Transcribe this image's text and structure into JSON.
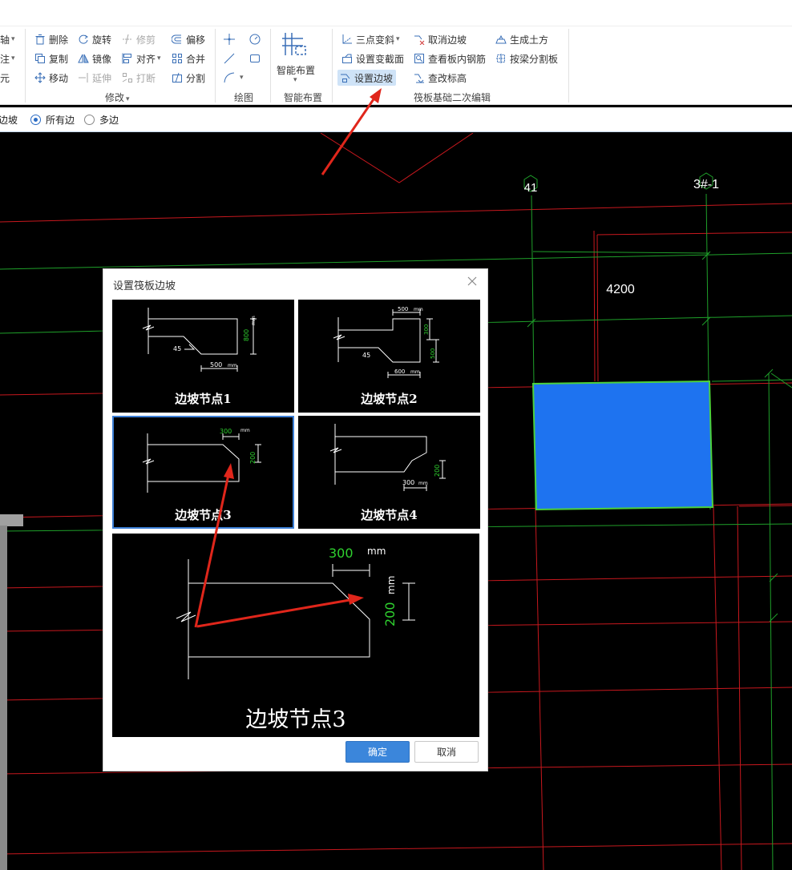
{
  "ribbon": {
    "cut_left": [
      "轴",
      "注",
      "元"
    ],
    "modify": {
      "delete": "删除",
      "rotate": "旋转",
      "trim": "修剪",
      "offset": "偏移",
      "copy": "复制",
      "mirror": "镜像",
      "align": "对齐",
      "merge": "合并",
      "move": "移动",
      "extend": "延伸",
      "break": "打断",
      "split": "分割",
      "group": "修改"
    },
    "draw": {
      "group": "绘图"
    },
    "smart": {
      "button": "智能布置",
      "group": "智能布置"
    },
    "raft": {
      "three_point_slope": "三点变斜",
      "cancel_slope": "取消边坡",
      "gen_earthwork": "生成土方",
      "set_section": "设置变截面",
      "view_rebar": "查看板内钢筋",
      "split_by_beam": "按梁分割板",
      "set_slope": "设置边坡",
      "change_elev": "查改标高",
      "group": "筏板基础二次编辑"
    }
  },
  "optbar": {
    "left_cut": "边坡",
    "opt_all": "所有边",
    "opt_multi": "多边"
  },
  "canvas": {
    "label_41": "41",
    "label_3": "3#-1",
    "dim_4200": "4200",
    "fill_color": "#1e73f0"
  },
  "dialog": {
    "title": "设置筏板边坡",
    "nodes": [
      {
        "caption": "边坡节点1",
        "t1": "800",
        "t2": "mm",
        "t3": "45",
        "t4": "500",
        "t5": "mm"
      },
      {
        "caption": "边坡节点2",
        "t1": "500",
        "t2": "mm",
        "t3": "300",
        "t4": "500",
        "t5": "45",
        "t6": "600",
        "t7": "mm"
      },
      {
        "caption": "边坡节点3",
        "t1": "300",
        "t2": "mm",
        "t3": "200"
      },
      {
        "caption": "边坡节点4",
        "t1": "200",
        "t2": "300",
        "t3": "mm"
      }
    ],
    "preview": {
      "caption": "边坡节点3",
      "w": "300",
      "unit_top": "mm",
      "h": "200",
      "unit_side": "mm"
    },
    "ok": "确定",
    "cancel": "取消"
  },
  "colors": {
    "accent": "#3b86db",
    "cad_red": "#c8181e",
    "cad_green": "#1fa02a",
    "highlight_fill": "#1e73f0"
  }
}
